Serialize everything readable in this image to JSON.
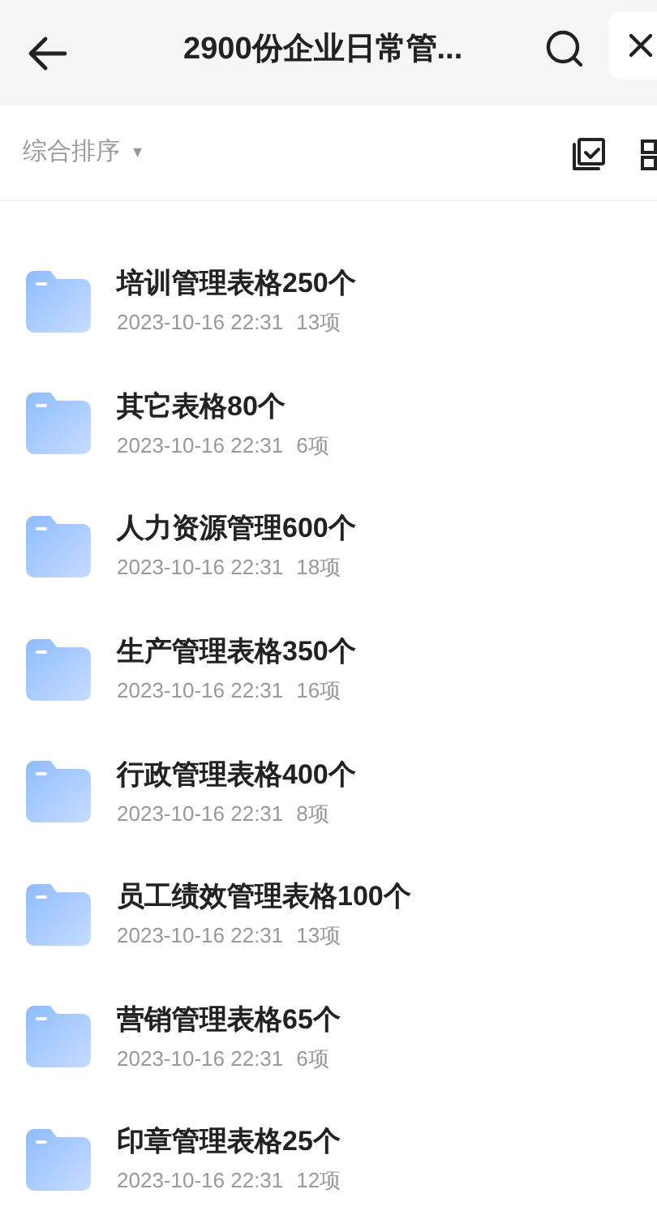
{
  "header": {
    "title": "2900份企业日常管..."
  },
  "sort": {
    "label": "综合排序",
    "caret": "▾"
  },
  "folders": [
    {
      "name": "培训管理表格250个",
      "date": "2023-10-16 22:31",
      "count": "13项"
    },
    {
      "name": "其它表格80个",
      "date": "2023-10-16 22:31",
      "count": "6项"
    },
    {
      "name": "人力资源管理600个",
      "date": "2023-10-16 22:31",
      "count": "18项"
    },
    {
      "name": "生产管理表格350个",
      "date": "2023-10-16 22:31",
      "count": "16项"
    },
    {
      "name": "行政管理表格400个",
      "date": "2023-10-16 22:31",
      "count": "8项"
    },
    {
      "name": "员工绩效管理表格100个",
      "date": "2023-10-16 22:31",
      "count": "13项"
    },
    {
      "name": "营销管理表格65个",
      "date": "2023-10-16 22:31",
      "count": "6项"
    },
    {
      "name": "印章管理表格25个",
      "date": "2023-10-16 22:31",
      "count": "12项"
    }
  ]
}
